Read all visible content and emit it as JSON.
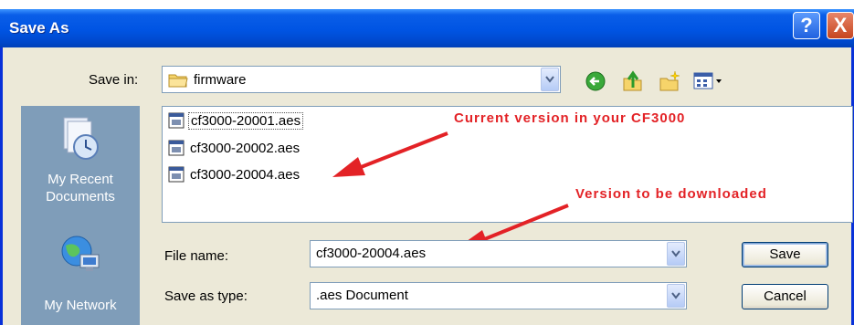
{
  "window": {
    "title": "Save As"
  },
  "title_buttons": {
    "help": "?",
    "close": "X"
  },
  "save_in": {
    "label": "Save in:",
    "value": "firmware"
  },
  "places": [
    {
      "label": "My Recent Documents",
      "line1": "My Recent",
      "line2": "Documents",
      "icon": "recent-documents-icon"
    },
    {
      "label": "My Network",
      "line1": "My Network",
      "icon": "network-icon"
    }
  ],
  "files": [
    {
      "name": "cf3000-20001.aes",
      "icon": "aes-file-icon"
    },
    {
      "name": "cf3000-20002.aes",
      "icon": "aes-file-icon"
    },
    {
      "name": "cf3000-20004.aes",
      "icon": "aes-file-icon"
    }
  ],
  "file_name": {
    "label": "File name:",
    "value": "cf3000-20004.aes"
  },
  "save_as_type": {
    "label": "Save as type:",
    "value": ".aes Document"
  },
  "buttons": {
    "save": "Save",
    "cancel": "Cancel"
  },
  "annotations": {
    "current": "Current version in your CF3000",
    "download": "Version to be downloaded"
  },
  "colors": {
    "title_bar": "#0054e3",
    "annotation": "#e32226",
    "dialog_bg": "#ece9d8"
  }
}
